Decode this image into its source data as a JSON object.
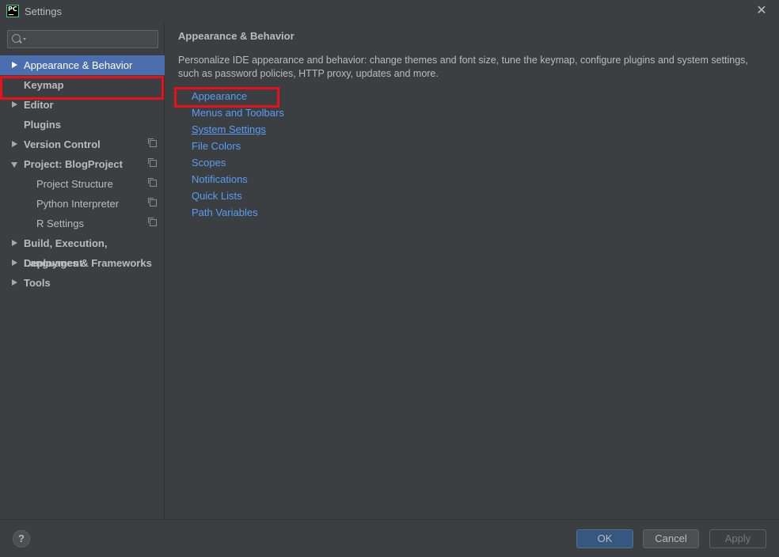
{
  "window": {
    "title": "Settings",
    "app_icon_text": "PC",
    "close_glyph": "✕"
  },
  "search": {
    "value": "",
    "placeholder": ""
  },
  "sidebar": {
    "items": [
      {
        "label": "Appearance & Behavior",
        "expandable": true,
        "expanded": false,
        "selected": true,
        "bold": false
      },
      {
        "label": "Keymap",
        "expandable": false,
        "bold": true
      },
      {
        "label": "Editor",
        "expandable": true,
        "bold": true
      },
      {
        "label": "Plugins",
        "expandable": false,
        "bold": true
      },
      {
        "label": "Version Control",
        "expandable": true,
        "bold": true,
        "project_scoped": true
      },
      {
        "label": "Project: BlogProject",
        "expandable": true,
        "expanded": true,
        "bold": true,
        "project_scoped": true
      },
      {
        "label": "Project Structure",
        "sub": true,
        "project_scoped": true
      },
      {
        "label": "Python Interpreter",
        "sub": true,
        "project_scoped": true
      },
      {
        "label": "R Settings",
        "sub": true,
        "project_scoped": true
      },
      {
        "label": "Build, Execution, Deployment",
        "expandable": true,
        "bold": true
      },
      {
        "label": "Languages & Frameworks",
        "expandable": true,
        "bold": true
      },
      {
        "label": "Tools",
        "expandable": true,
        "bold": true
      }
    ]
  },
  "main": {
    "title": "Appearance & Behavior",
    "description": "Personalize IDE appearance and behavior: change themes and font size, tune the keymap, configure plugins and system settings, such as password policies, HTTP proxy, updates and more.",
    "links": [
      {
        "label": "Appearance"
      },
      {
        "label": "Menus and Toolbars"
      },
      {
        "label": "System Settings",
        "underlined": true
      },
      {
        "label": "File Colors"
      },
      {
        "label": "Scopes"
      },
      {
        "label": "Notifications"
      },
      {
        "label": "Quick Lists"
      },
      {
        "label": "Path Variables"
      }
    ]
  },
  "footer": {
    "help_label": "?",
    "ok_label": "OK",
    "cancel_label": "Cancel",
    "apply_label": "Apply"
  },
  "colors": {
    "background": "#3c3f41",
    "selection": "#4b6eaf",
    "link": "#589df6",
    "highlight_box": "#e8111a",
    "ok_button": "#365880"
  }
}
